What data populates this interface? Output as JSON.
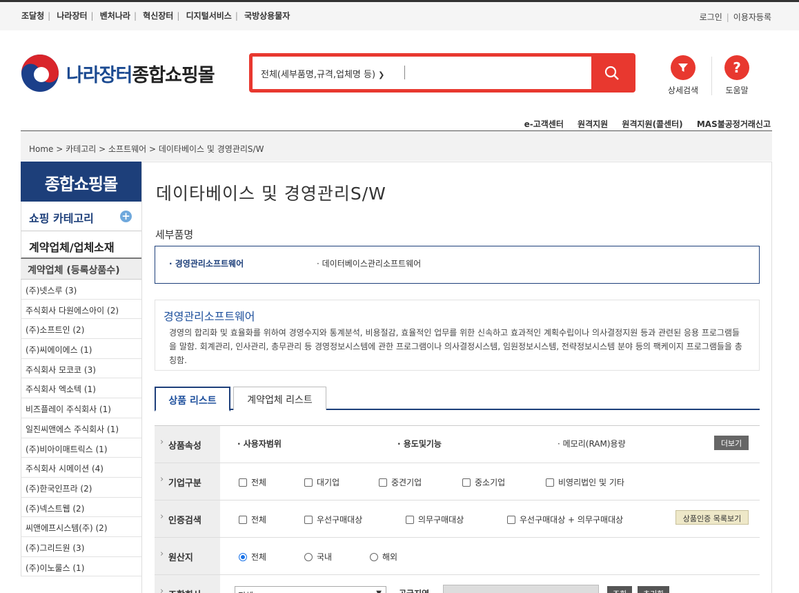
{
  "topbar": {
    "links": [
      "조달청",
      "나라장터",
      "벤처나라",
      "혁신장터",
      "디지털서비스",
      "국방상용물자"
    ],
    "login": "로그인",
    "register": "이용자등록"
  },
  "logo": {
    "part1": "나라장터",
    "part2": "종합쇼핑몰"
  },
  "search": {
    "scope": "전체(세부품명,규격,업체명 등)",
    "value": ""
  },
  "tools": {
    "detail_search": "상세검색",
    "help": "도움말"
  },
  "sublinks": [
    "e-고객센터",
    "원격지원",
    "원격지원(콜센터)",
    "MAS불공정거래신고"
  ],
  "breadcrumb": "Home > 카테고리 > 소프트웨어 > 데이타베이스 및 경영관리S/W",
  "sidebar": {
    "title": "종합쇼핑몰",
    "category": "쇼핑 카테고리",
    "vendors_title": "계약업체/업체소재",
    "vendors_sub": "계약업체 (등록상품수)",
    "vendors": [
      "(주)넷스루 (3)",
      "주식회사 다원에스아이 (2)",
      "(주)소프트인 (2)",
      "(주)씨에이에스 (1)",
      "주식회사 모코코 (3)",
      "주식회사 엑소텍 (1)",
      "비즈플레이 주식회사 (1)",
      "일진씨앤에스 주식회사 (1)",
      "(주)비아이매트릭스 (1)",
      "주식회사 시메이션 (4)",
      "(주)한국인프라 (2)",
      "(주)넥스트웹 (2)",
      "씨앤에프시스템(주) (2)",
      "(주)그리드원 (3)",
      "(주)이노룰스 (1)"
    ]
  },
  "main": {
    "title": "데이타베이스 및 경영관리S/W",
    "detail_label": "세부품명",
    "detail_items": [
      "경영관리소프트웨어",
      "데이터베이스관리소프트웨어"
    ],
    "desc_title": "경영관리소프트웨어",
    "desc_text": "경영의 합리화 및 효율화를 위하여 경영수지와 통계분석, 비용절감, 효율적인 업무를 위한 신속하고 효과적인 계획수립이나 의사결정지원 등과 관련된 응용 프로그램들을 말함. 회계관리, 인사관리, 총무관리 등 경영정보시스템에 관한 프로그램이나 의사결정시스템, 임원정보시스템, 전략정보시스템 분야 등의 팩케이지 프로그램들을 총칭함.",
    "tabs": [
      "상품 리스트",
      "계약업체 리스트"
    ]
  },
  "filters": {
    "attr_label": "상품속성",
    "attrs": [
      "사용자범위",
      "용도및기능",
      "메모리(RAM)용량"
    ],
    "more": "더보기",
    "company_label": "기업구분",
    "company_opts": [
      "전체",
      "대기업",
      "중견기업",
      "중소기업",
      "비영리법인 및 기타"
    ],
    "cert_label": "인증검색",
    "cert_opts": [
      "전체",
      "우선구매대상",
      "의무구매대상",
      "우선구매대상 + 의무구매대상"
    ],
    "cert_btn": "상품인증 목록보기",
    "origin_label": "원산지",
    "origin_opts": [
      "전체",
      "국내",
      "해외"
    ],
    "vendor_label": "조합회사",
    "vendor_select": "전체",
    "supply_label": "공급지역",
    "search_btn": "조회",
    "reset_btn": "초기화"
  }
}
